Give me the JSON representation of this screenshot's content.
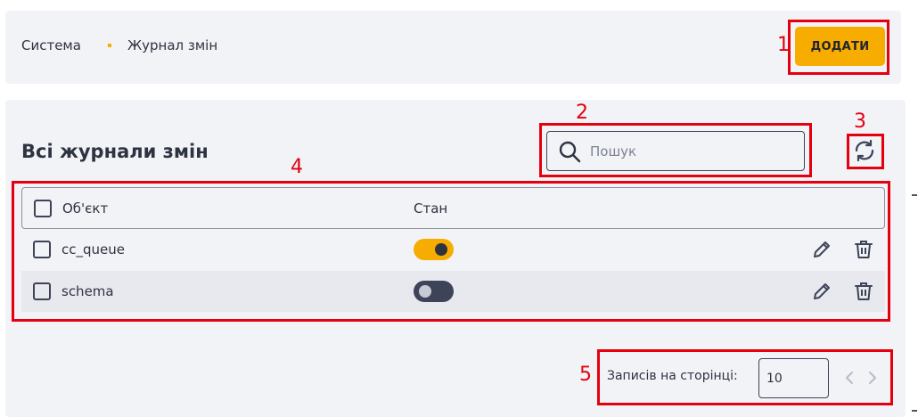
{
  "breadcrumb": {
    "root": "Система",
    "current": "Журнал змін"
  },
  "header": {
    "add_label": "ДОДАТИ"
  },
  "main": {
    "title": "Всі журнали змін"
  },
  "search": {
    "placeholder": "Пошук",
    "value": ""
  },
  "table": {
    "columns": [
      "Об'єкт",
      "Стан"
    ],
    "rows": [
      {
        "object": "cc_queue",
        "enabled": true
      },
      {
        "object": "schema",
        "enabled": false
      }
    ]
  },
  "pagination": {
    "label": "Записів на сторінці:",
    "page_size": "10"
  },
  "annotations": [
    "1",
    "2",
    "3",
    "4",
    "5"
  ],
  "colors": {
    "accent": "#f7ac00",
    "annotation": "#e4000f",
    "dark": "#3d4458"
  },
  "icons": [
    "search-icon",
    "refresh-icon",
    "edit-icon",
    "trash-icon",
    "chevron-left-icon",
    "chevron-right-icon"
  ]
}
